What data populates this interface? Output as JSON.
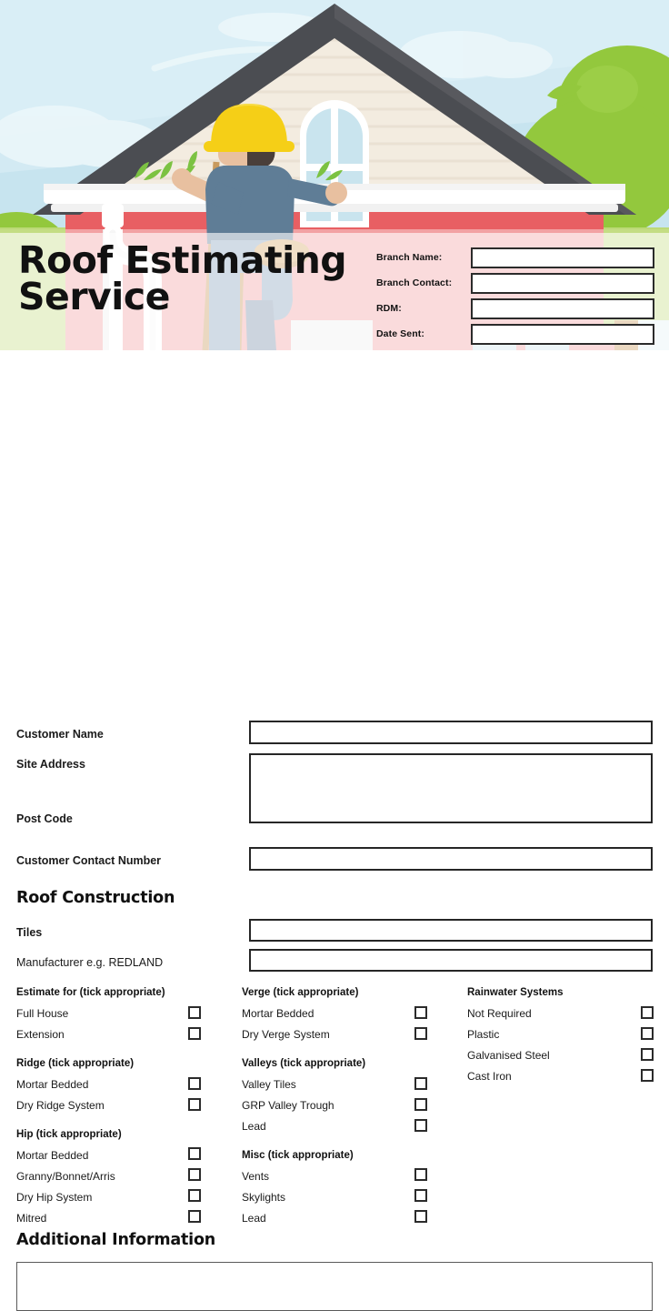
{
  "header": {
    "title_line1": "Roof Estimating",
    "title_line2": "Service",
    "title": "Roof Estimating Service",
    "illustration_name": "roofer-on-ladder-house-illustration",
    "branch_fields": [
      {
        "label": "Branch Name:",
        "value": "",
        "name": "branch-name"
      },
      {
        "label": "Branch Contact:",
        "value": "",
        "name": "branch-contact"
      },
      {
        "label": "RDM:",
        "value": "",
        "name": "rdm"
      },
      {
        "label": "Date Sent:",
        "value": "",
        "name": "date-sent"
      }
    ]
  },
  "customer": {
    "name_label": "Customer Name",
    "name_value": "",
    "site_address_label": "Site Address",
    "site_address_value": "",
    "post_code_label": "Post Code",
    "contact_number_label": "Customer Contact Number",
    "contact_number_value": ""
  },
  "roof_construction": {
    "heading": "Roof Construction",
    "tiles_label": "Tiles",
    "tiles_value": "",
    "manufacturer_label": "Manufacturer e.g. REDLAND",
    "manufacturer_value": ""
  },
  "checkbox_groups": {
    "column1": [
      {
        "heading": "Estimate for (tick appropriate)",
        "items": [
          {
            "label": "Full House",
            "checked": false
          },
          {
            "label": "Extension",
            "checked": false
          }
        ]
      },
      {
        "heading": "Ridge (tick appropriate)",
        "items": [
          {
            "label": "Mortar Bedded",
            "checked": false
          },
          {
            "label": "Dry Ridge System",
            "checked": false
          }
        ]
      },
      {
        "heading": "Hip (tick appropriate)",
        "items": [
          {
            "label": "Mortar Bedded",
            "checked": false
          },
          {
            "label": "Granny/Bonnet/Arris",
            "checked": false
          },
          {
            "label": "Dry Hip System",
            "checked": false
          },
          {
            "label": "Mitred",
            "checked": false
          }
        ]
      }
    ],
    "column2": [
      {
        "heading": "Verge (tick appropriate)",
        "items": [
          {
            "label": "Mortar Bedded",
            "checked": false
          },
          {
            "label": "Dry Verge System",
            "checked": false
          }
        ]
      },
      {
        "heading": "Valleys (tick appropriate)",
        "items": [
          {
            "label": "Valley Tiles",
            "checked": false
          },
          {
            "label": "GRP Valley Trough",
            "checked": false
          },
          {
            "label": "Lead",
            "checked": false
          }
        ]
      },
      {
        "heading": "Misc (tick appropriate)",
        "items": [
          {
            "label": "Vents",
            "checked": false
          },
          {
            "label": "Skylights",
            "checked": false
          },
          {
            "label": "Lead",
            "checked": false
          }
        ]
      }
    ],
    "column3": [
      {
        "heading": "Rainwater Systems",
        "items": [
          {
            "label": "Not Required",
            "checked": false
          },
          {
            "label": "Plastic",
            "checked": false
          },
          {
            "label": "Galvanised Steel",
            "checked": false
          },
          {
            "label": "Cast Iron",
            "checked": false
          }
        ]
      }
    ]
  },
  "additional_information": {
    "heading": "Additional Information",
    "value": ""
  },
  "colors": {
    "sky": "#cfe9f2",
    "sky_band": "#bfe0ec",
    "tree_green": "#93c83d",
    "wall_pink": "#f2a1a3",
    "wall_red": "#e85f63",
    "roof_dark": "#4b4d52",
    "gable_cream": "#f2ece0",
    "trim_white": "#ffffff",
    "helmet_yellow": "#f5cf17",
    "shirt_blue": "#5f7d96",
    "jeans_blue": "#8aa2bd",
    "skin": "#e8c0a0",
    "ladder_wood": "#c89a5e",
    "border_dark": "#262626",
    "text_dark": "#1a1a1a"
  }
}
